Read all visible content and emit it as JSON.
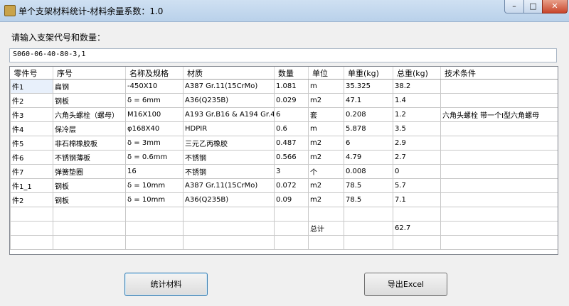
{
  "window": {
    "title": "单个支架材料统计-材料余量系数：1.0",
    "min_label": "–",
    "max_label": "□",
    "close_label": "✕"
  },
  "form": {
    "prompt": "请输入支架代号和数量：",
    "input_value": "S060-06-40-80-3,1"
  },
  "table": {
    "headers": [
      "零件号",
      "序号",
      "名称及规格",
      "材质",
      "数量",
      "单位",
      "单重(kg)",
      "总重(kg)",
      "技术条件"
    ],
    "rows": [
      [
        "件1",
        "扁钢",
        "-450X10",
        "A387 Gr.11(15CrMo)",
        "1.081",
        "m",
        "35.325",
        "38.2",
        ""
      ],
      [
        "件2",
        "钢板",
        "δ = 6mm",
        "A36(Q235B)",
        "0.029",
        "m2",
        "47.1",
        "1.4",
        ""
      ],
      [
        "件3",
        "六角头螺栓（螺母）",
        "M16X100",
        "A193 Gr.B16 & A194 Gr.4",
        "6",
        "套",
        "0.208",
        "1.2",
        "六角头螺栓 带一个I型六角螺母"
      ],
      [
        "件4",
        "保冷层",
        "φ168X40",
        "HDPIR",
        "0.6",
        "m",
        "5.878",
        "3.5",
        ""
      ],
      [
        "件5",
        "非石棉橡胶板",
        "δ = 3mm",
        "三元乙丙橡胶",
        "0.487",
        "m2",
        "6",
        "2.9",
        ""
      ],
      [
        "件6",
        "不锈钢薄板",
        "δ = 0.6mm",
        "不锈钢",
        "0.566",
        "m2",
        "4.79",
        "2.7",
        ""
      ],
      [
        "件7",
        "弹簧垫圈",
        "16",
        "不锈钢",
        "3",
        "个",
        "0.008",
        "0",
        ""
      ],
      [
        "件1_1",
        "钢板",
        "δ = 10mm",
        "A387 Gr.11(15CrMo)",
        "0.072",
        "m2",
        "78.5",
        "5.7",
        ""
      ],
      [
        "件2",
        "钢板",
        "δ = 10mm",
        "A36(Q235B)",
        "0.09",
        "m2",
        "78.5",
        "7.1",
        ""
      ],
      [
        "",
        "",
        "",
        "",
        "",
        "",
        "",
        "",
        ""
      ],
      [
        "",
        "",
        "",
        "",
        "",
        "总计",
        "",
        "62.7",
        ""
      ],
      [
        "",
        "",
        "",
        "",
        "",
        "",
        "",
        "",
        ""
      ]
    ]
  },
  "buttons": {
    "stat_label": "统计材料",
    "export_label": "导出Excel"
  }
}
